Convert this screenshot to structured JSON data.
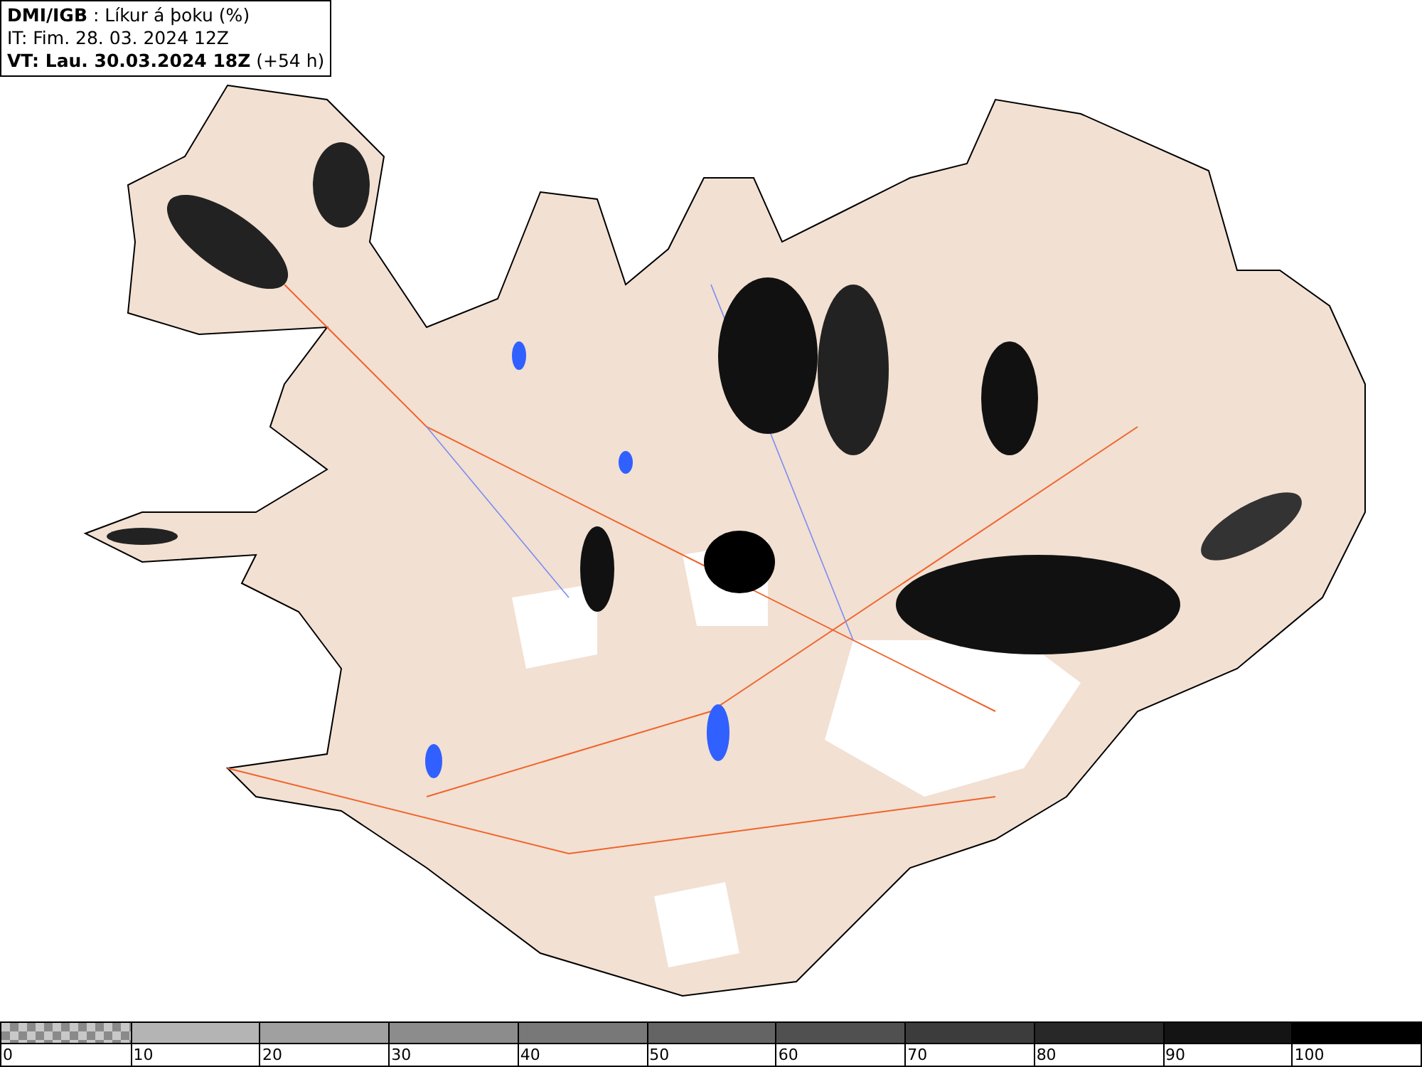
{
  "info_box": {
    "lines": [
      "**DMI/IGB** : Líkur á þoku (%)",
      "IT: Fim. 28. 03. 2024 12Z",
      "**VT: Lau. 30.03.2024 18Z** (+54 h)"
    ]
  },
  "legend": {
    "bins": [
      {
        "kind": "checker",
        "color": "#8a8a8a"
      },
      {
        "kind": "solid",
        "color": "#b4b4b4"
      },
      {
        "kind": "solid",
        "color": "#a0a0a0"
      },
      {
        "kind": "solid",
        "color": "#8c8c8c"
      },
      {
        "kind": "solid",
        "color": "#787878"
      },
      {
        "kind": "solid",
        "color": "#646464"
      },
      {
        "kind": "solid",
        "color": "#505050"
      },
      {
        "kind": "solid",
        "color": "#3c3c3c"
      },
      {
        "kind": "solid",
        "color": "#282828"
      },
      {
        "kind": "solid",
        "color": "#141414"
      },
      {
        "kind": "solid",
        "color": "#000000"
      }
    ],
    "ticks": [
      "0",
      "10",
      "20",
      "30",
      "40",
      "50",
      "60",
      "70",
      "80",
      "90",
      "100"
    ]
  }
}
